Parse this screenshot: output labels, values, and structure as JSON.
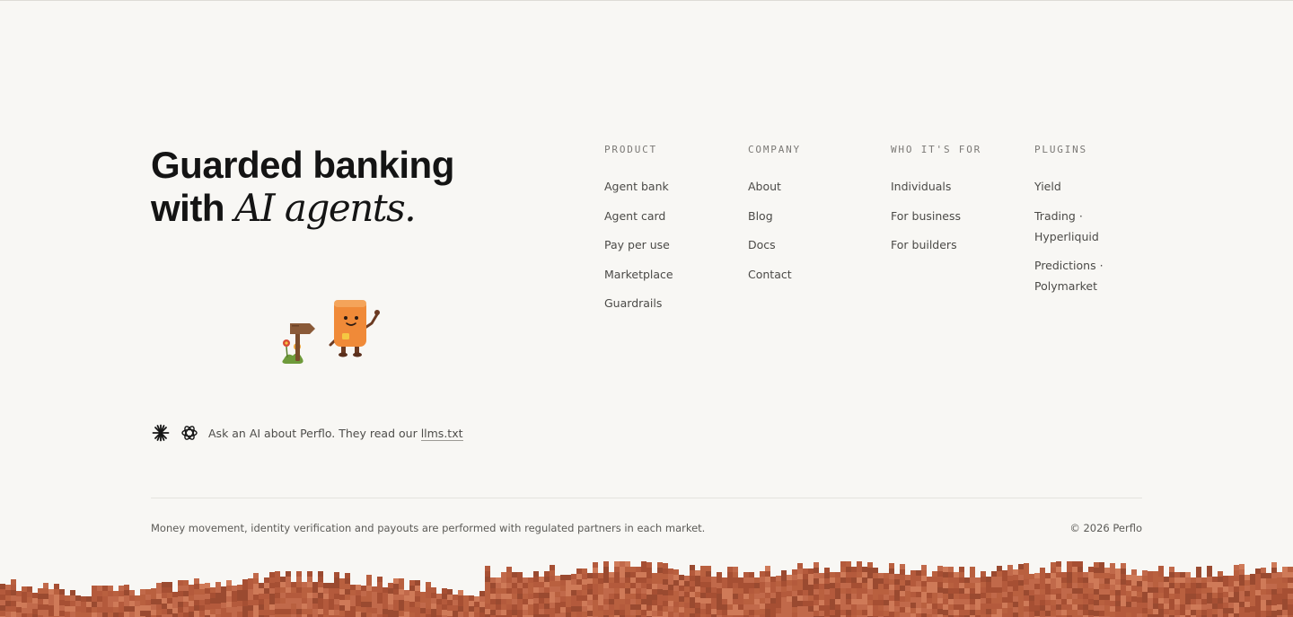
{
  "hero": {
    "line1": "Guarded banking",
    "line2_prefix": "with",
    "line2_emphasis": "AI agents."
  },
  "ai_prompt": {
    "text": "Ask an AI about Perflo. They read our",
    "link_label": "llms.txt",
    "icons": [
      "claude-icon",
      "openai-icon"
    ]
  },
  "columns": [
    {
      "heading": "PRODUCT",
      "items": [
        "Agent bank",
        "Agent card",
        "Pay per use",
        "Marketplace",
        "Guardrails"
      ]
    },
    {
      "heading": "COMPANY",
      "items": [
        "About",
        "Blog",
        "Docs",
        "Contact"
      ]
    },
    {
      "heading": "WHO IT'S FOR",
      "items": [
        "Individuals",
        "For business",
        "For builders"
      ]
    },
    {
      "heading": "PLUGINS",
      "items": [
        "Yield",
        "Trading · Hyperliquid",
        "Predictions · Polymarket"
      ]
    }
  ],
  "footer": {
    "legal": "Money movement, identity verification and payouts are performed with regulated partners in each market.",
    "copyright": "© 2026 Perflo"
  },
  "colors": {
    "background": "#f8f7f4",
    "ground": "#b45a3c",
    "card": "#f08a38",
    "signpost": "#8a5a38"
  }
}
